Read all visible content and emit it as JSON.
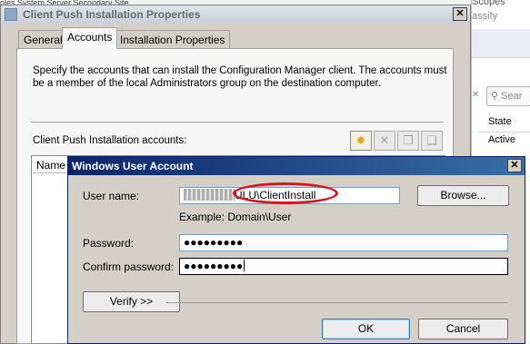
{
  "background": {
    "top_strip_text": "oles   System Server   Secondary Site",
    "scopes_label": "Scopes",
    "classify_label": "assify",
    "search_placeholder": "Sear",
    "state_column": "State",
    "state_value": "Active"
  },
  "dialog": {
    "title": "Client Push Installation Properties",
    "close_glyph": "✕",
    "tabs": [
      {
        "label": "General"
      },
      {
        "label": "Accounts"
      },
      {
        "label": "Installation Properties"
      }
    ],
    "description": "Specify the accounts that can install the Configuration Manager client. The accounts must be a member of the local Administrators group on the destination computer.",
    "accounts_label": "Client Push Installation accounts:",
    "toolbar": [
      {
        "icon": "new-star-icon",
        "glyph": "✸"
      },
      {
        "icon": "delete-x-icon",
        "glyph": "✕"
      },
      {
        "icon": "properties-icon",
        "glyph": "❐"
      },
      {
        "icon": "copy-icon",
        "glyph": "❏"
      }
    ],
    "list_header": "Name"
  },
  "user_account_dialog": {
    "title": "Windows User Account",
    "close_glyph": "✕",
    "user_name_label": "User name:",
    "user_name_value_suffix": "ULU\\ClientInstall",
    "example_text": "Example: Domain\\User",
    "password_label": "Password:",
    "password_value": "●●●●●●●●●",
    "confirm_password_label": "Confirm password:",
    "confirm_password_value": "●●●●●●●●●",
    "browse_label": "Browse...",
    "verify_label": "Verify >>",
    "ok_label": "OK",
    "cancel_label": "Cancel",
    "highlight_color": "#d8141d"
  }
}
